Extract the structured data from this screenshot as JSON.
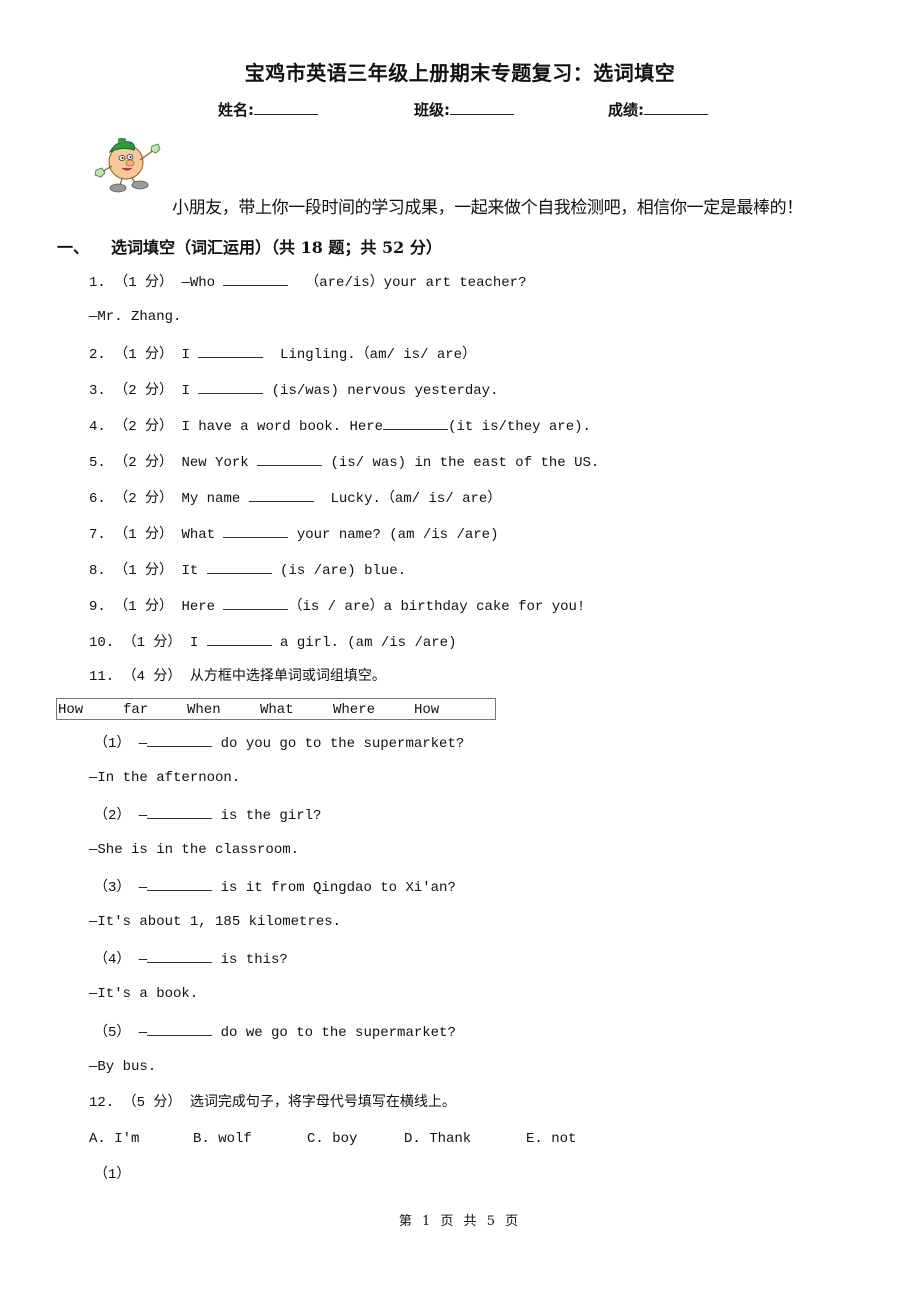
{
  "header": {
    "title": "宝鸡市英语三年级上册期末专题复习：选词填空",
    "name_label": "姓名:",
    "class_label": "班级:",
    "score_label": "成绩:",
    "blank": "________"
  },
  "intro": {
    "mascot_icon": "cartoon-mascot",
    "text": "小朋友，带上你一段时间的学习成果，一起来做个自我检测吧，相信你一定是最棒的！"
  },
  "section": {
    "number": "一、",
    "title": "选词填空（词汇运用）（共 18 题；共 52 分）"
  },
  "questions": [
    {
      "num": "1.",
      "score": "（1 分）",
      "before": "—Who ",
      "after": "  （are/is）your art teacher?",
      "answer_line": "—Mr. Zhang."
    },
    {
      "num": "2.",
      "score": "（1 分）",
      "before": "I ",
      "after": "  Lingling.（am/ is/ are）"
    },
    {
      "num": "3.",
      "score": "（2 分）",
      "before": "I ",
      "after": " (is/was) nervous yesterday."
    },
    {
      "num": "4.",
      "score": "（2 分）",
      "before": "I have a word book. Here",
      "after": "(it is/they are)."
    },
    {
      "num": "5.",
      "score": "（2 分）",
      "before": "New York ",
      "after": " (is/ was) in the east of the US."
    },
    {
      "num": "6.",
      "score": "（2 分）",
      "before": "My name ",
      "after": "  Lucky.（am/ is/ are）"
    },
    {
      "num": "7.",
      "score": "（1 分）",
      "before": "What ",
      "after": " your name? (am /is /are)"
    },
    {
      "num": "8.",
      "score": "（1 分）",
      "before": "It ",
      "after": " (is /are) blue."
    },
    {
      "num": "9.",
      "score": "（1 分）",
      "before": "Here ",
      "after": "（is / are）a birthday cake for you!"
    },
    {
      "num": "10.",
      "score": "（1 分）",
      "before": "I ",
      "after": " a girl. (am /is /are)"
    }
  ],
  "q11": {
    "num": "11.",
    "score": "（4 分）",
    "instruction": "从方框中选择单词或词组填空。",
    "word_box": [
      "How",
      "far",
      "When",
      "What",
      "Where",
      "How"
    ],
    "items": [
      {
        "label": "（1）",
        "prompt_after": " do you go to the supermarket?",
        "answer": "—In the afternoon."
      },
      {
        "label": "（2）",
        "prompt_after": " is the girl?",
        "answer": "—She is in the classroom."
      },
      {
        "label": "（3）",
        "prompt_after": " is it from Qingdao to Xi'an?",
        "answer": "—It's about 1, 185 kilometres."
      },
      {
        "label": "（4）",
        "prompt_after": " is this?",
        "answer": "—It's a book."
      },
      {
        "label": "（5）",
        "prompt_after": " do we go to the supermarket?",
        "answer": "—By bus."
      }
    ]
  },
  "q12": {
    "num": "12.",
    "score": "（5 分）",
    "instruction": "选词完成句子，将字母代号填写在横线上。",
    "options": [
      "A. I'm",
      "B. wolf",
      "C. boy",
      "D. Thank",
      "E. not"
    ],
    "first_item": "（1）"
  },
  "footer": {
    "page_text": "第 1 页 共 5 页"
  }
}
